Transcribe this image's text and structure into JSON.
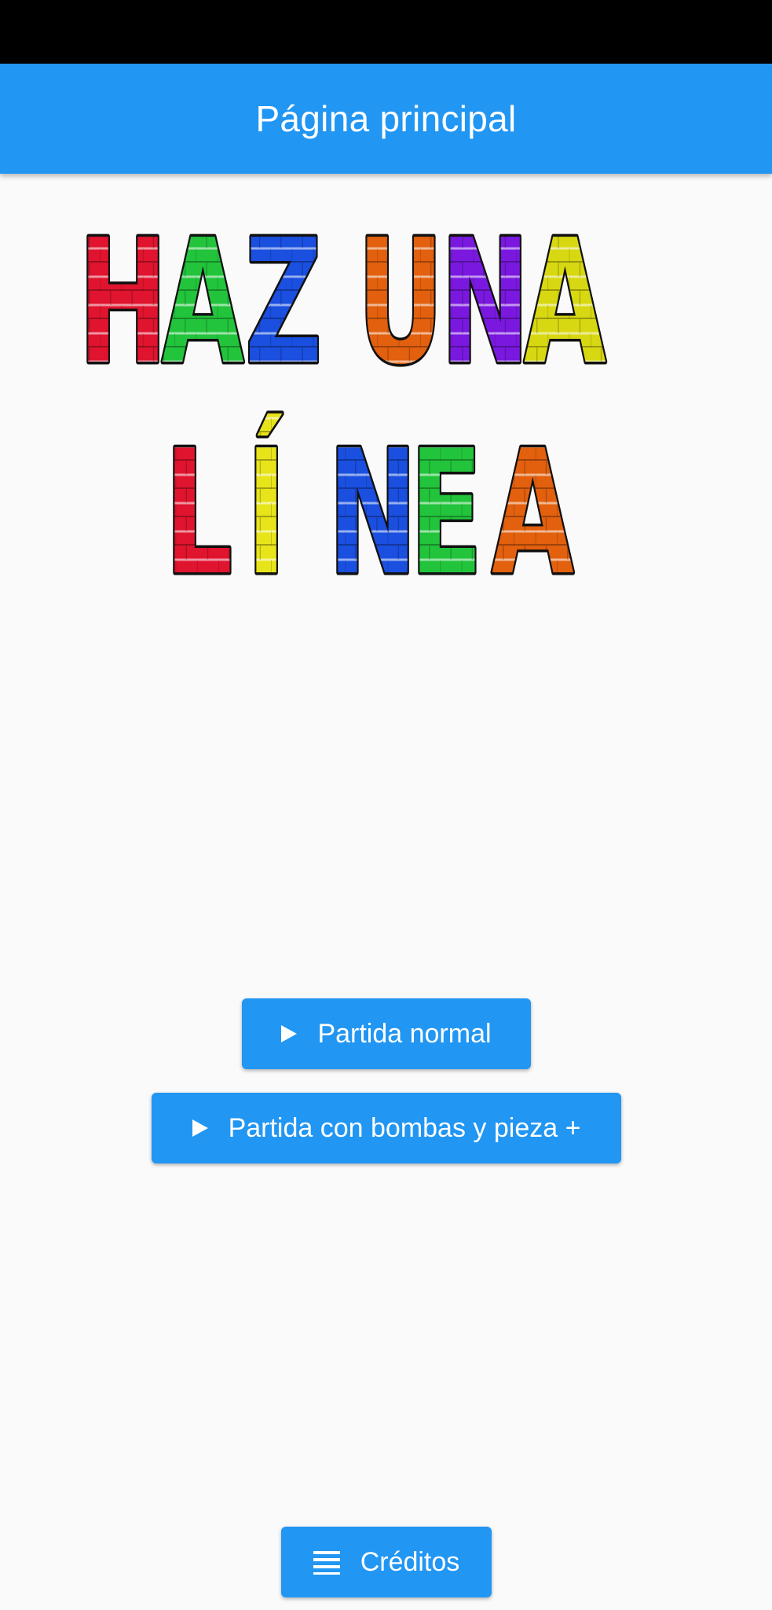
{
  "app_bar": {
    "title": "Página principal",
    "color": "#2196f3"
  },
  "logo": {
    "line1": "HAZ UNA",
    "line2": "LÍNEA",
    "line1_colors": [
      "#e0142e",
      "#22c43c",
      "#1a4fe0",
      "#e2600e",
      "#7a18e0",
      "#d8d812"
    ],
    "line2_colors": [
      "#e0142e",
      "#e8e41a",
      "#1a4fe0",
      "#22c43c",
      "#e2600e"
    ]
  },
  "buttons": {
    "normal": {
      "label": "Partida normal",
      "icon": "play-icon"
    },
    "bombs": {
      "label": "Partida con bombas y pieza +",
      "icon": "play-icon"
    },
    "credits": {
      "label": "Créditos",
      "icon": "list-icon"
    }
  }
}
